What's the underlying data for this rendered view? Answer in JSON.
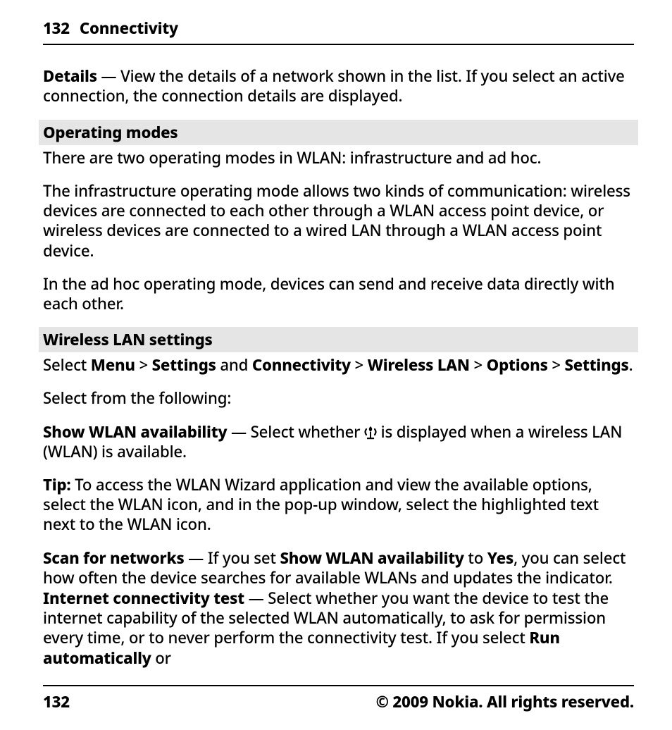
{
  "header": {
    "page_number": "132",
    "section": "Connectivity"
  },
  "body": {
    "details_label": "Details",
    "details_sep": "  — ",
    "details_text": "View the details of a network shown in the list. If you select an active connection, the connection details are displayed.",
    "section_operating_modes": "Operating modes",
    "op_p1": "There are two operating modes in WLAN: infrastructure and ad hoc.",
    "op_p2": "The infrastructure operating mode allows two kinds of communication: wireless devices are connected to each other through a WLAN access point device, or wireless devices are connected to a wired LAN through a WLAN access point device.",
    "op_p3": "In the ad hoc operating mode, devices can send and receive data directly with each other.",
    "section_wlan_settings": "Wireless LAN settings",
    "nav": {
      "prefix": "Select ",
      "menu": "Menu",
      "sep": " > ",
      "settings": "Settings",
      "and": " and ",
      "connectivity": "Connectivity",
      "wlan": "Wireless LAN",
      "options": "Options",
      "settings2": "Settings",
      "period": "."
    },
    "select_from": "Select from the following:",
    "show_wlan_label": "Show WLAN availability",
    "show_wlan_pre": "  — Select whether ",
    "show_wlan_post": " is displayed when a wireless LAN (WLAN) is available.",
    "tip_label": "Tip:",
    "tip_text": " To access the WLAN Wizard application and view the available options, select the WLAN icon, and in the pop-up window, select the highlighted text next to the WLAN icon.",
    "scan_label": "Scan for networks",
    "scan_pre": "  — If you set ",
    "scan_bold_inline": "Show WLAN availability",
    "scan_mid": " to ",
    "scan_yes": "Yes",
    "scan_post": ", you can select how often the device searches for available WLANs and updates the indicator.",
    "ict_label": "Internet connectivity test",
    "ict_pre": "  — Select whether you want the device to test the internet capability of the selected WLAN automatically, to ask for permission every time, or to never perform the connectivity test. If you select ",
    "ict_run_auto": "Run automatically",
    "ict_or": " or"
  },
  "footer": {
    "page_number": "132",
    "copyright": "© 2009 Nokia. All rights reserved."
  }
}
